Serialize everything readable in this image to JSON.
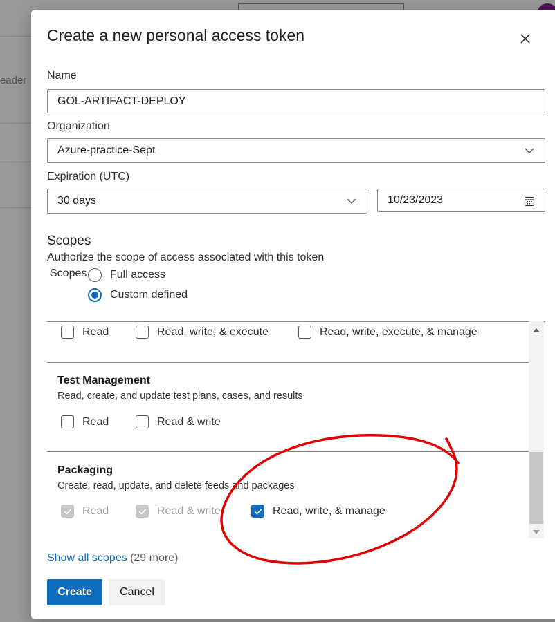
{
  "background": {
    "partial_text": "eader"
  },
  "dialog": {
    "title": "Create a new personal access token",
    "name_label": "Name",
    "name_value": "GOL-ARTIFACT-DEPLOY",
    "organization_label": "Organization",
    "organization_value": "Azure-practice-Sept",
    "expiration_label": "Expiration (UTC)",
    "expiration_value": "30 days",
    "expiration_date": "10/23/2023",
    "scopes_title": "Scopes",
    "scopes_description": "Authorize the scope of access associated with this token",
    "scopes_inline_label": "Scopes",
    "radio_full": "Full access",
    "radio_custom": "Custom defined",
    "radio_selected": "Custom defined",
    "top_row": {
      "read": "Read",
      "rwe": "Read, write, & execute",
      "rwem": "Read, write, execute, & manage"
    },
    "test_management": {
      "title": "Test Management",
      "description": "Read, create, and update test plans, cases, and results",
      "read": "Read",
      "read_write": "Read & write"
    },
    "packaging": {
      "title": "Packaging",
      "description": "Create, read, update, and delete feeds and packages",
      "read": "Read",
      "read_write": "Read & write",
      "rwm": "Read, write, & manage",
      "rwm_checked": true
    },
    "show_all_link": "Show all scopes",
    "show_all_count": "(29 more)",
    "create_label": "Create",
    "cancel_label": "Cancel"
  },
  "colors": {
    "accent": "#0f6cbd",
    "annotation_red": "#e00000"
  },
  "icons": {
    "close": "close-icon",
    "dropdown": "chevron-down-icon",
    "calendar": "calendar-icon",
    "checkmark": "checkmark-icon",
    "scroll_up": "scroll-up-icon",
    "scroll_down": "scroll-down-icon"
  }
}
